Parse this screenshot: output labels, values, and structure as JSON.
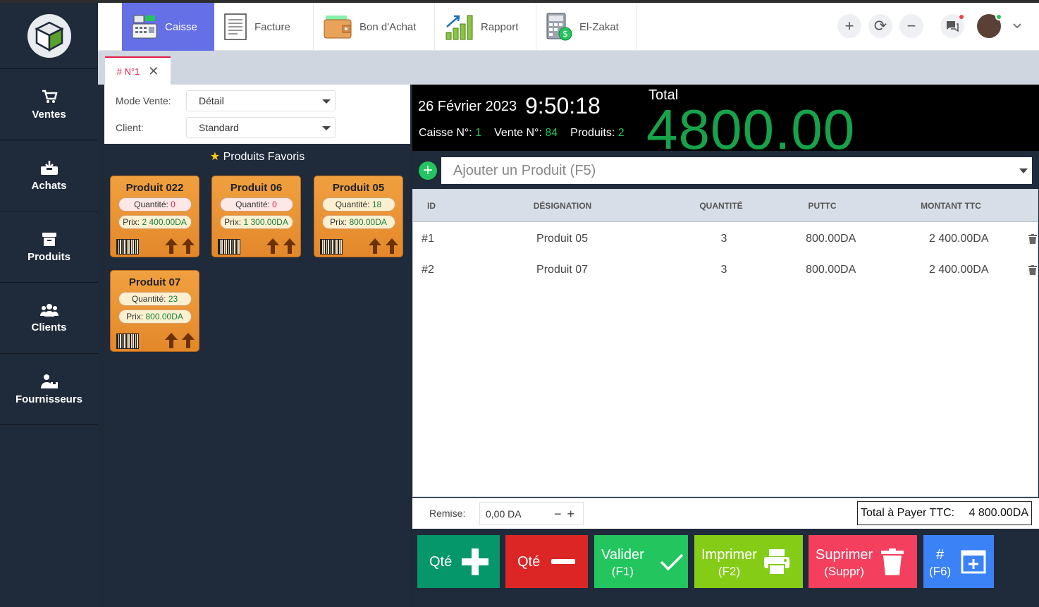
{
  "sidebar": {
    "items": [
      {
        "label": "Ventes",
        "icon": "cart-icon"
      },
      {
        "label": "Achats",
        "icon": "inbox-icon"
      },
      {
        "label": "Produits",
        "icon": "box-icon"
      },
      {
        "label": "Clients",
        "icon": "users-icon"
      },
      {
        "label": "Fournisseurs",
        "icon": "supplier-icon"
      }
    ]
  },
  "topnav": {
    "tabs": [
      {
        "label": "Caisse",
        "icon": "cash-register-icon"
      },
      {
        "label": "Facture",
        "icon": "invoice-icon"
      },
      {
        "label": "Bon d'Achat",
        "icon": "wallet-icon"
      },
      {
        "label": "Rapport",
        "icon": "chart-icon"
      },
      {
        "label": "El-Zakat",
        "icon": "calculator-icon"
      }
    ],
    "plus": "+",
    "refresh": "⟳",
    "minus": "−"
  },
  "doc_tab": {
    "label": "# N°1",
    "close": "✕"
  },
  "form": {
    "mode_label": "Mode Vente:",
    "mode_value": "Détail",
    "client_label": "Client:",
    "client_value": "Standard"
  },
  "favorites": {
    "title": "Produits Favoris",
    "qty_label": "Quantité:",
    "price_label": "Prix:",
    "products": [
      {
        "name": "Produit 022",
        "qty": "0",
        "price": "2 400.00DA"
      },
      {
        "name": "Produit 06",
        "qty": "0",
        "price": "1 300.00DA"
      },
      {
        "name": "Produit 05",
        "qty": "18",
        "price": "800.00DA"
      },
      {
        "name": "Produit 07",
        "qty": "23",
        "price": "800.00DA"
      }
    ]
  },
  "header": {
    "date": "26 Février 2023",
    "time": "9:50:18",
    "caisse_label": "Caisse N°:",
    "caisse_value": "1",
    "vente_label": "Vente N°:",
    "vente_value": "84",
    "produits_label": "Produits:",
    "produits_value": "2",
    "total_label": "Total",
    "total_value": "4800.00"
  },
  "add_product": {
    "placeholder": "Ajouter un Produit (F5)"
  },
  "table": {
    "headers": [
      "ID",
      "DÉSIGNATION",
      "QUANTITÉ",
      "PUTTC",
      "MONTANT TTC"
    ],
    "rows": [
      {
        "id": "#1",
        "designation": "Produit 05",
        "qty": "3",
        "puttc": "800.00DA",
        "montant": "2 400.00DA"
      },
      {
        "id": "#2",
        "designation": "Produit 07",
        "qty": "3",
        "puttc": "800.00DA",
        "montant": "2 400.00DA"
      }
    ]
  },
  "footer": {
    "remise_label": "Remise:",
    "remise_value": "0,00 DA",
    "total_pay_label": "Total à Payer TTC:",
    "total_pay_value": "4 800.00DA"
  },
  "actions": {
    "qty_plus": "Qté",
    "qty_minus": "Qté",
    "valider": "Valider",
    "valider_key": "(F1)",
    "imprimer": "Imprimer",
    "imprimer_key": "(F2)",
    "suprimer": "Suprimer",
    "suprimer_key": "(Suppr)",
    "new": "#",
    "new_key": "(F6)"
  },
  "colors": {
    "sidebar": "#1f2a3a",
    "active_tab": "#6570e6",
    "total_green": "#16a34a",
    "card_orange": "#e3882a",
    "btn_qty_plus": "#059669",
    "btn_qty_minus": "#dc2626",
    "btn_valider": "#22c55e",
    "btn_imprimer": "#84cc16",
    "btn_suprimer": "#f43f5e",
    "btn_new": "#3b82f6"
  }
}
